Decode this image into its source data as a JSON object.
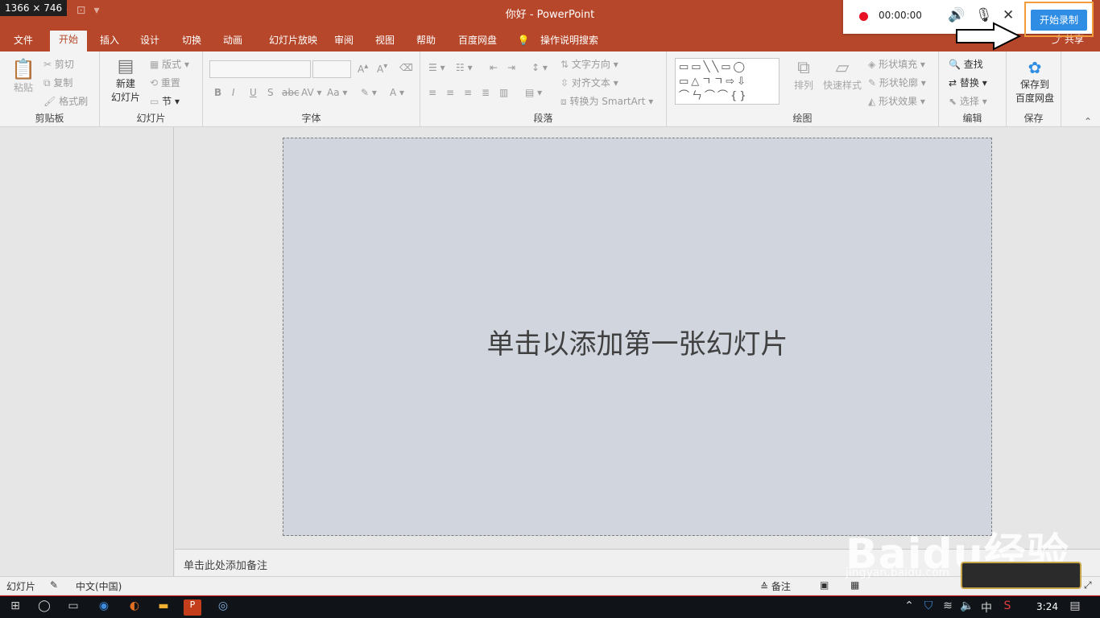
{
  "screen_tag": "1366 × 746",
  "window": {
    "title": "你好  -  PowerPoint"
  },
  "tabs": [
    {
      "label": "文件"
    },
    {
      "label": "开始"
    },
    {
      "label": "插入"
    },
    {
      "label": "设计"
    },
    {
      "label": "切换"
    },
    {
      "label": "动画"
    },
    {
      "label": "幻灯片放映"
    },
    {
      "label": "审阅"
    },
    {
      "label": "视图"
    },
    {
      "label": "帮助"
    },
    {
      "label": "百度网盘"
    }
  ],
  "tell_me": "操作说明搜索",
  "share": "共享",
  "ribbon": {
    "clipboard": {
      "label": "剪贴板",
      "paste": "粘贴",
      "cut": "剪切",
      "copy": "复制",
      "format_painter": "格式刷"
    },
    "slides": {
      "label": "幻灯片",
      "new_slide_1": "新建",
      "new_slide_2": "幻灯片",
      "layout": "版式",
      "reset": "重置",
      "section": "节"
    },
    "font": {
      "label": "字体"
    },
    "paragraph": {
      "label": "段落",
      "text_direction": "文字方向",
      "align_text": "对齐文本",
      "convert_smartart": "转换为 SmartArt"
    },
    "drawing": {
      "label": "绘图",
      "arrange": "排列",
      "quick_styles": "快速样式",
      "shape_fill": "形状填充",
      "shape_outline": "形状轮廓",
      "shape_effects": "形状效果"
    },
    "editing": {
      "label": "编辑",
      "find": "查找",
      "replace": "替换",
      "select": "选择"
    },
    "save": {
      "label": "保存",
      "save_to_1": "保存到",
      "save_to_2": "百度网盘"
    }
  },
  "slide": {
    "placeholder": "单击以添加第一张幻灯片"
  },
  "notes": {
    "placeholder": "单击此处添加备注"
  },
  "status": {
    "slide": "幻灯片",
    "language": "中文(中国)",
    "notes": "备注"
  },
  "recorder": {
    "time": "00:00:00",
    "start_label": "开始录制"
  },
  "taskbar": {
    "clock": "3:24",
    "ime": "中"
  },
  "watermark": {
    "brand": "Baidu经验",
    "url": "jingyan.baidu.com"
  }
}
